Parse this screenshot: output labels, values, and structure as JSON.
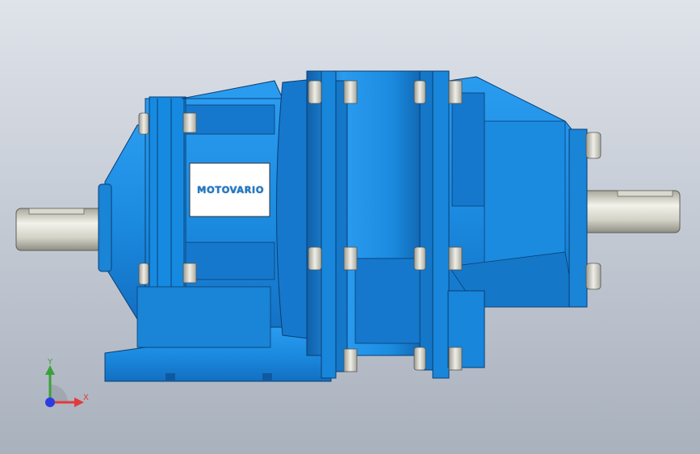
{
  "model": {
    "brand_label": "MOTOVARIO"
  },
  "triad": {
    "x_label": "X",
    "y_label": "Y",
    "x_color": "#e23b3b",
    "y_color": "#3aa13a",
    "z_color": "#2b3de0"
  },
  "colors": {
    "housing": "#1e8ee0",
    "housing_dark": "#0f5fa8",
    "shaft": "#d8d8cc",
    "bolt": "#cfcfc5"
  }
}
